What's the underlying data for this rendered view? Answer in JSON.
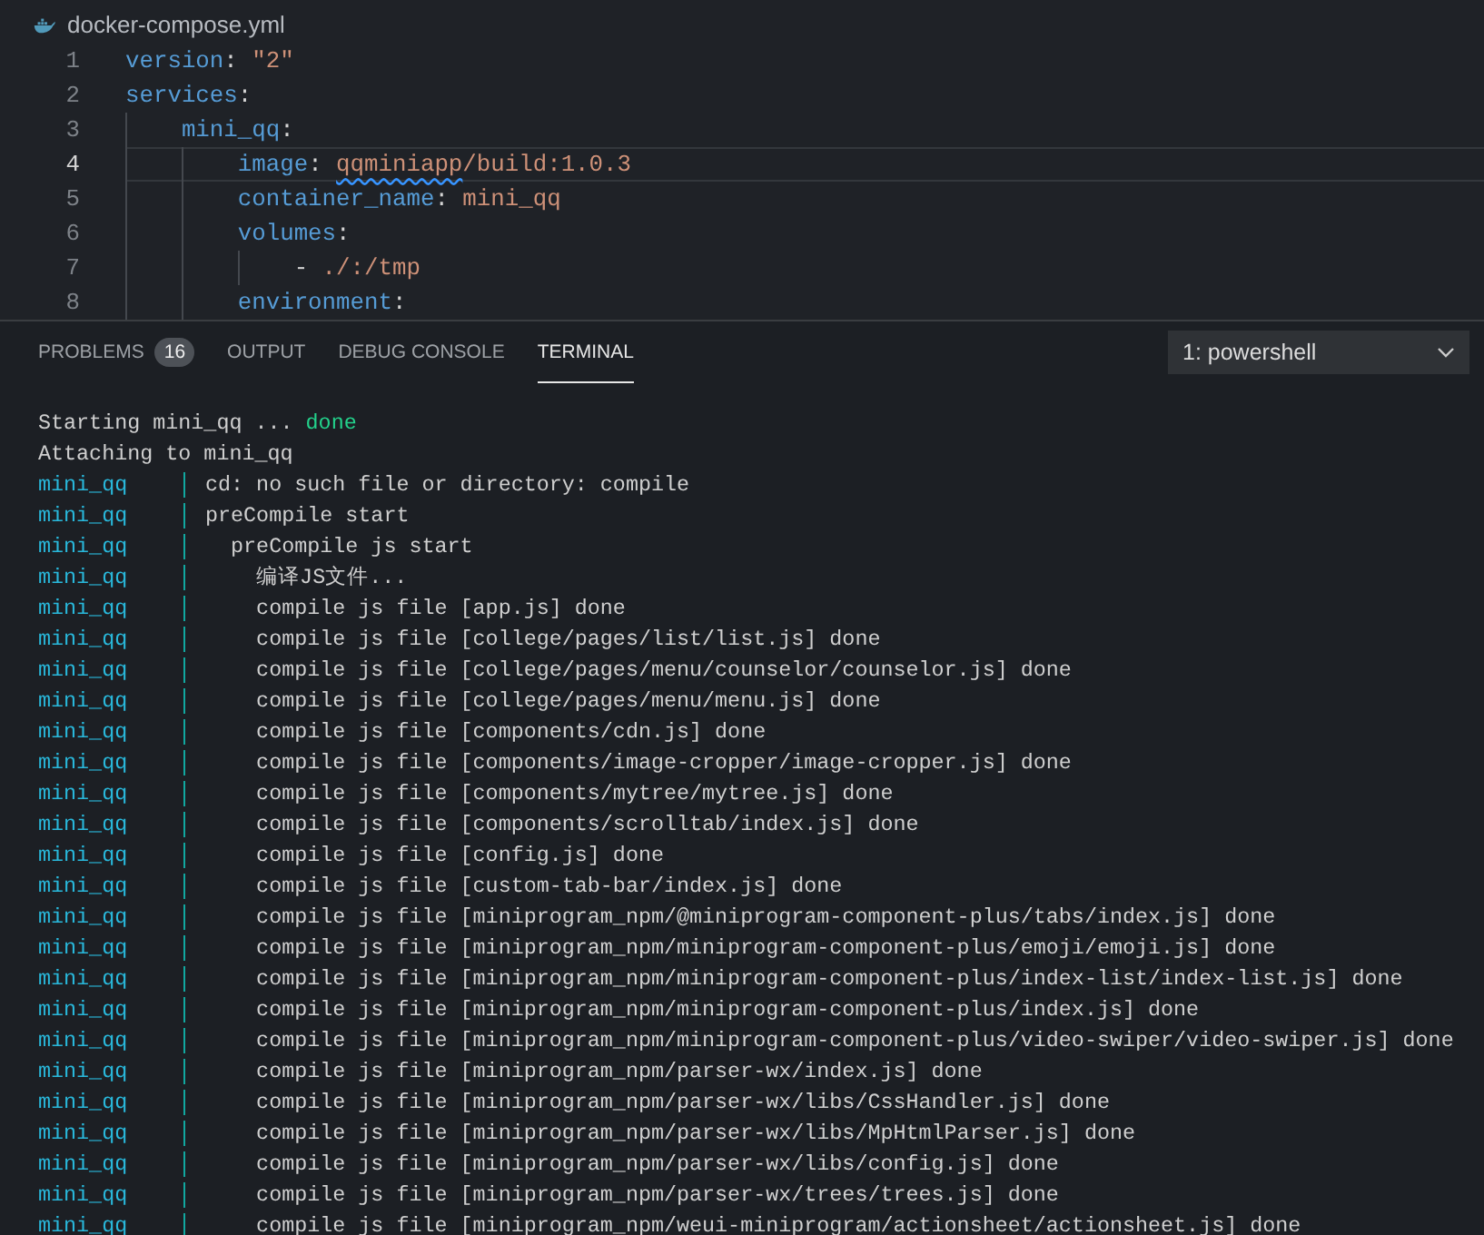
{
  "editor": {
    "tab": {
      "title": "docker-compose.yml"
    },
    "lines": [
      {
        "number": "1",
        "current": false,
        "tokens": [
          {
            "kind": "key",
            "text": "version"
          },
          {
            "kind": "punct",
            "text": ": "
          },
          {
            "kind": "string",
            "text": "\"2\""
          }
        ]
      },
      {
        "number": "2",
        "current": false,
        "tokens": [
          {
            "kind": "key",
            "text": "services"
          },
          {
            "kind": "punct",
            "text": ":"
          }
        ],
        "children": [
          {
            "number": "3",
            "current": false,
            "tokens": [
              {
                "kind": "key",
                "text": "mini_qq"
              },
              {
                "kind": "punct",
                "text": ":"
              }
            ],
            "children": [
              {
                "number": "4",
                "current": true,
                "tokens": [
                  {
                    "kind": "key",
                    "text": "image"
                  },
                  {
                    "kind": "punct",
                    "text": ": "
                  },
                  {
                    "kind": "warning",
                    "text": "qqminiapp"
                  },
                  {
                    "kind": "value",
                    "text": "/build:1.0.3"
                  }
                ]
              },
              {
                "number": "5",
                "current": false,
                "tokens": [
                  {
                    "kind": "key",
                    "text": "container_name"
                  },
                  {
                    "kind": "punct",
                    "text": ": "
                  },
                  {
                    "kind": "value",
                    "text": "mini_qq"
                  }
                ]
              },
              {
                "number": "6",
                "current": false,
                "tokens": [
                  {
                    "kind": "key",
                    "text": "volumes"
                  },
                  {
                    "kind": "punct",
                    "text": ":"
                  }
                ],
                "children": [
                  {
                    "number": "7",
                    "current": false,
                    "tokens": [
                      {
                        "kind": "punct",
                        "text": "- "
                      },
                      {
                        "kind": "value",
                        "text": "./:/tmp"
                      }
                    ]
                  }
                ]
              },
              {
                "number": "8",
                "current": false,
                "tokens": [
                  {
                    "kind": "key",
                    "text": "environment"
                  },
                  {
                    "kind": "punct",
                    "text": ":"
                  }
                ]
              }
            ]
          }
        ]
      }
    ]
  },
  "panel": {
    "tabs": [
      {
        "label": "PROBLEMS",
        "badge": "16",
        "selected": false
      },
      {
        "label": "OUTPUT",
        "selected": false
      },
      {
        "label": "DEBUG CONSOLE",
        "selected": false
      },
      {
        "label": "TERMINAL",
        "selected": true
      }
    ],
    "terminal_select": {
      "value": "1: powershell"
    },
    "terminal_lines": [
      {
        "kind": "plain",
        "text": "Starting mini_qq ...",
        "status": "done"
      },
      {
        "kind": "plain",
        "text": "Attaching to mini_qq"
      },
      {
        "kind": "service",
        "prefix": "mini_qq",
        "text": "cd: no such file or directory: compile"
      },
      {
        "kind": "service",
        "prefix": "mini_qq",
        "text": "preCompile start"
      },
      {
        "kind": "service",
        "prefix": "mini_qq",
        "text": "  preCompile js start"
      },
      {
        "kind": "service",
        "prefix": "mini_qq",
        "text": "    编译JS文件..."
      },
      {
        "kind": "service",
        "prefix": "mini_qq",
        "text": "    compile js file [app.js] done"
      },
      {
        "kind": "service",
        "prefix": "mini_qq",
        "text": "    compile js file [college/pages/list/list.js] done"
      },
      {
        "kind": "service",
        "prefix": "mini_qq",
        "text": "    compile js file [college/pages/menu/counselor/counselor.js] done"
      },
      {
        "kind": "service",
        "prefix": "mini_qq",
        "text": "    compile js file [college/pages/menu/menu.js] done"
      },
      {
        "kind": "service",
        "prefix": "mini_qq",
        "text": "    compile js file [components/cdn.js] done"
      },
      {
        "kind": "service",
        "prefix": "mini_qq",
        "text": "    compile js file [components/image-cropper/image-cropper.js] done"
      },
      {
        "kind": "service",
        "prefix": "mini_qq",
        "text": "    compile js file [components/mytree/mytree.js] done"
      },
      {
        "kind": "service",
        "prefix": "mini_qq",
        "text": "    compile js file [components/scrolltab/index.js] done"
      },
      {
        "kind": "service",
        "prefix": "mini_qq",
        "text": "    compile js file [config.js] done"
      },
      {
        "kind": "service",
        "prefix": "mini_qq",
        "text": "    compile js file [custom-tab-bar/index.js] done"
      },
      {
        "kind": "service",
        "prefix": "mini_qq",
        "text": "    compile js file [miniprogram_npm/@miniprogram-component-plus/tabs/index.js] done"
      },
      {
        "kind": "service",
        "prefix": "mini_qq",
        "text": "    compile js file [miniprogram_npm/miniprogram-component-plus/emoji/emoji.js] done"
      },
      {
        "kind": "service",
        "prefix": "mini_qq",
        "text": "    compile js file [miniprogram_npm/miniprogram-component-plus/index-list/index-list.js] done"
      },
      {
        "kind": "service",
        "prefix": "mini_qq",
        "text": "    compile js file [miniprogram_npm/miniprogram-component-plus/index.js] done"
      },
      {
        "kind": "service",
        "prefix": "mini_qq",
        "text": "    compile js file [miniprogram_npm/miniprogram-component-plus/video-swiper/video-swiper.js] done"
      },
      {
        "kind": "service",
        "prefix": "mini_qq",
        "text": "    compile js file [miniprogram_npm/parser-wx/index.js] done"
      },
      {
        "kind": "service",
        "prefix": "mini_qq",
        "text": "    compile js file [miniprogram_npm/parser-wx/libs/CssHandler.js] done"
      },
      {
        "kind": "service",
        "prefix": "mini_qq",
        "text": "    compile js file [miniprogram_npm/parser-wx/libs/MpHtmlParser.js] done"
      },
      {
        "kind": "service",
        "prefix": "mini_qq",
        "text": "    compile js file [miniprogram_npm/parser-wx/libs/config.js] done"
      },
      {
        "kind": "service",
        "prefix": "mini_qq",
        "text": "    compile js file [miniprogram_npm/parser-wx/trees/trees.js] done"
      },
      {
        "kind": "service",
        "prefix": "mini_qq",
        "text": "    compile js file [miniprogram_npm/weui-miniprogram/actionsheet/actionsheet.js] done"
      }
    ]
  }
}
